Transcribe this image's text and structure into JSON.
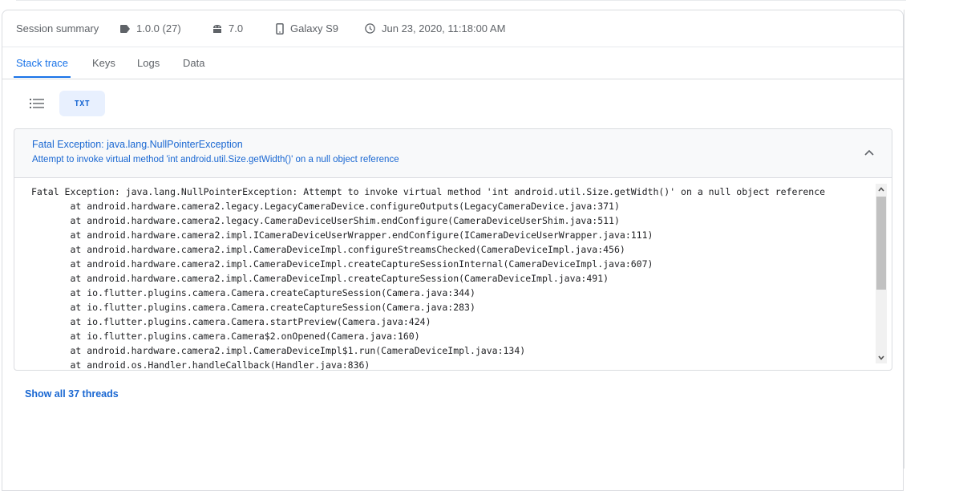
{
  "summary": {
    "title": "Session summary",
    "app_version": "1.0.0 (27)",
    "android_version": "7.0",
    "device": "Galaxy S9",
    "timestamp": "Jun 23, 2020, 11:18:00 AM",
    "icons": [
      "tag-icon",
      "android-icon",
      "phone-icon",
      "clock-icon"
    ]
  },
  "tabs": [
    {
      "label": "Stack trace",
      "active": true
    },
    {
      "label": "Keys",
      "active": false
    },
    {
      "label": "Logs",
      "active": false
    },
    {
      "label": "Data",
      "active": false
    }
  ],
  "view_toggle": {
    "list_icon": "list-icon",
    "txt_label": "TXT"
  },
  "exception": {
    "title": "Fatal Exception: java.lang.NullPointerException",
    "message": "Attempt to invoke virtual method 'int android.util.Size.getWidth()' on a null object reference",
    "collapse_icon": "chevron-up-icon"
  },
  "stack_trace": [
    "Fatal Exception: java.lang.NullPointerException: Attempt to invoke virtual method 'int android.util.Size.getWidth()' on a null object reference",
    "       at android.hardware.camera2.legacy.LegacyCameraDevice.configureOutputs(LegacyCameraDevice.java:371)",
    "       at android.hardware.camera2.legacy.CameraDeviceUserShim.endConfigure(CameraDeviceUserShim.java:511)",
    "       at android.hardware.camera2.impl.ICameraDeviceUserWrapper.endConfigure(ICameraDeviceUserWrapper.java:111)",
    "       at android.hardware.camera2.impl.CameraDeviceImpl.configureStreamsChecked(CameraDeviceImpl.java:456)",
    "       at android.hardware.camera2.impl.CameraDeviceImpl.createCaptureSessionInternal(CameraDeviceImpl.java:607)",
    "       at android.hardware.camera2.impl.CameraDeviceImpl.createCaptureSession(CameraDeviceImpl.java:491)",
    "       at io.flutter.plugins.camera.Camera.createCaptureSession(Camera.java:344)",
    "       at io.flutter.plugins.camera.Camera.createCaptureSession(Camera.java:283)",
    "       at io.flutter.plugins.camera.Camera.startPreview(Camera.java:424)",
    "       at io.flutter.plugins.camera.Camera$2.onOpened(Camera.java:160)",
    "       at android.hardware.camera2.impl.CameraDeviceImpl$1.run(CameraDeviceImpl.java:134)",
    "       at android.os.Handler.handleCallback(Handler.java:836)"
  ],
  "footer": {
    "show_all_label": "Show all 37 threads"
  },
  "colors": {
    "accent": "#1a73e8",
    "link": "#1967d2",
    "txt_button_bg": "#e8f0fe"
  }
}
